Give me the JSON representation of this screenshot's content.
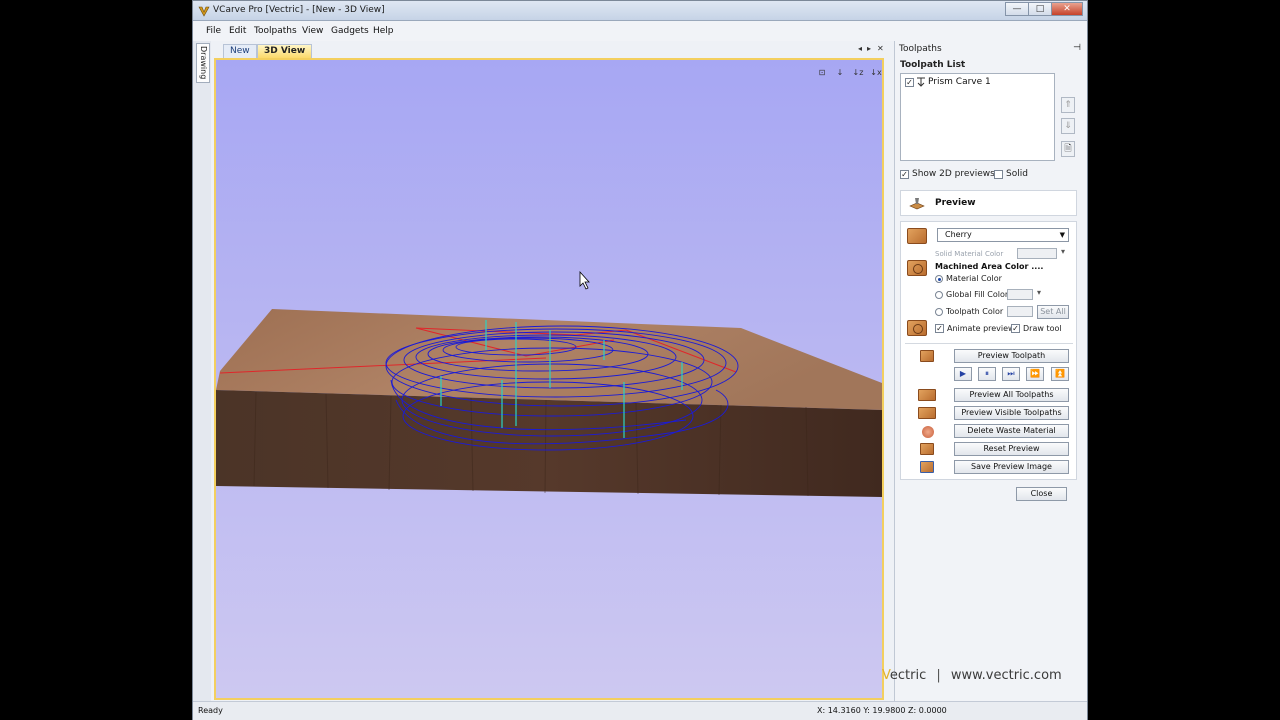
{
  "window": {
    "title": "VCarve Pro [Vectric] - [New - 3D View]",
    "btn_minimize": "—",
    "btn_maximize": "□",
    "btn_close": "✕"
  },
  "menu": [
    "File",
    "Edit",
    "Toolpaths",
    "View",
    "Gadgets",
    "Help"
  ],
  "left_dock": {
    "drawing_tab": "Drawing"
  },
  "tabs": {
    "new": "New",
    "view3d": "3D View",
    "nav_left": "◂",
    "nav_right": "▸",
    "nav_close": "✕"
  },
  "view_tools": [
    "⊡",
    "↓",
    "↓z",
    "↓x",
    "↓y"
  ],
  "status": {
    "ready": "Ready",
    "coords": "X: 14.3160 Y: 19.9800  Z:  0.0000"
  },
  "toolpaths_panel": {
    "title": "Toolpaths",
    "pin": "⊣",
    "list_title": "Toolpath List",
    "items": [
      {
        "name": "Prism Carve 1",
        "checked": true
      }
    ],
    "side_buttons": {
      "up": "⇑",
      "down": "⇓",
      "delete": "🗎"
    },
    "show_2d_previews": "Show 2D previews",
    "solid": "Solid"
  },
  "preview": {
    "title": "Preview",
    "material": "Cherry",
    "solid_material_color": "Solid Material Color",
    "machined_area_color": "Machined Area Color ....",
    "opt_material_color": "Material Color",
    "opt_global_fill": "Global Fill Color",
    "opt_toolpath_color": "Toolpath Color",
    "set_all": "Set All",
    "animate_preview": "Animate preview",
    "draw_tool": "Draw tool",
    "preview_toolpath": "Preview Toolpath",
    "controls": [
      "▶",
      "⏸",
      "⏭",
      "⏩",
      "⏫"
    ],
    "preview_all": "Preview All Toolpaths",
    "preview_visible": "Preview Visible Toolpaths",
    "delete_waste": "Delete Waste Material",
    "reset_preview": "Reset Preview",
    "save_image": "Save Preview Image",
    "close": "Close"
  },
  "brand": {
    "v": "V",
    "rest": "ectric",
    "sep": "|",
    "url": "www.vectric.com"
  },
  "colors": {
    "accent_tab": "#fbd96a",
    "sky_top": "#a9a9f3",
    "sky_bottom": "#c8c4f0",
    "wood_top": "#a8795b",
    "wood_side": "#4a3326",
    "toolpath": "#1b1bd6"
  }
}
